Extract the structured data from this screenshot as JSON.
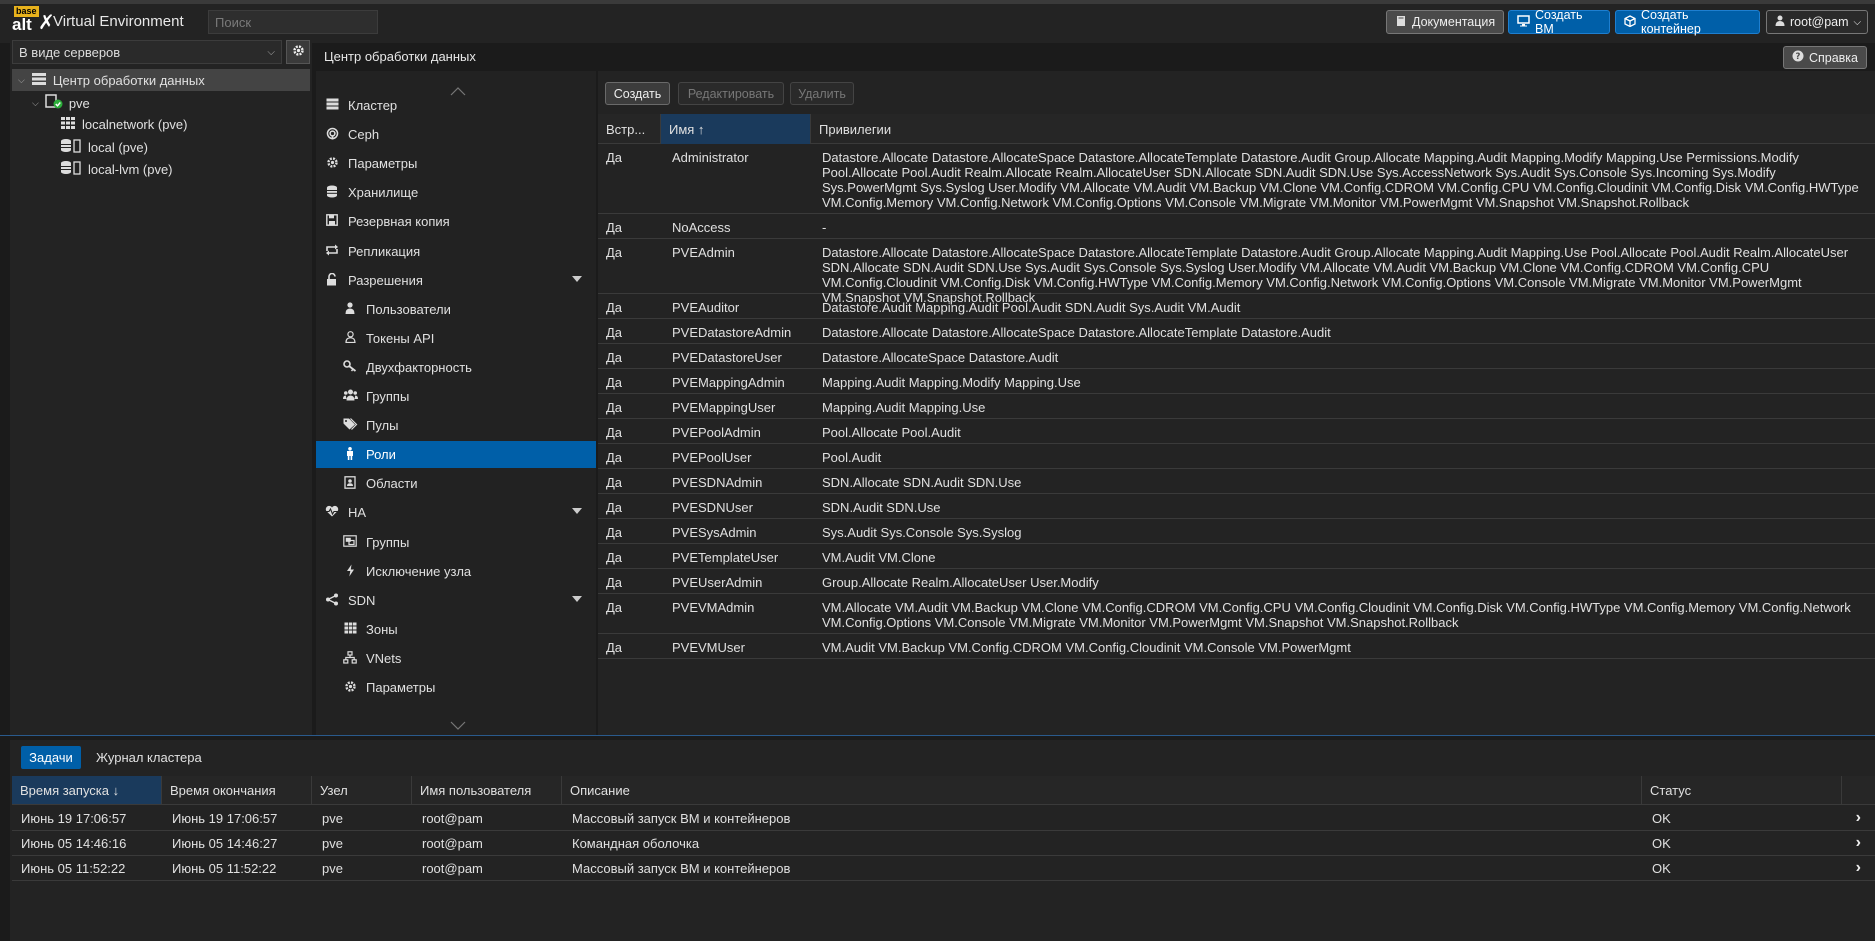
{
  "app": {
    "logo_top": "base",
    "logo_bottom": "alt",
    "title": "Virtual Environment",
    "search_placeholder": "Поиск"
  },
  "topbar": {
    "docs": "Документация",
    "create_vm": "Создать ВМ",
    "create_ct": "Создать контейнер",
    "user": "root@pam"
  },
  "tree": {
    "view": "В виде серверов",
    "datacenter": "Центр обработки данных",
    "node": "pve",
    "storages": [
      "localnetwork (pve)",
      "local (pve)",
      "local-lvm (pve)"
    ]
  },
  "content": {
    "title": "Центр обработки данных",
    "help": "Справка"
  },
  "nav": {
    "items": [
      {
        "label": "Кластер",
        "icon": "server-icon",
        "level": 0
      },
      {
        "label": "Ceph",
        "icon": "ceph-icon",
        "level": 0
      },
      {
        "label": "Параметры",
        "icon": "gear-icon",
        "level": 0
      },
      {
        "label": "Хранилище",
        "icon": "database-icon",
        "level": 0
      },
      {
        "label": "Резервная копия",
        "icon": "floppy-icon",
        "level": 0
      },
      {
        "label": "Репликация",
        "icon": "retweet-icon",
        "level": 0
      },
      {
        "label": "Разрешения",
        "icon": "unlock-icon",
        "level": 0
      },
      {
        "label": "Пользователи",
        "icon": "user-icon",
        "level": 1
      },
      {
        "label": "Токены API",
        "icon": "user-outline-icon",
        "level": 1
      },
      {
        "label": "Двухфакторность",
        "icon": "key-icon",
        "level": 1
      },
      {
        "label": "Группы",
        "icon": "users-icon",
        "level": 1
      },
      {
        "label": "Пулы",
        "icon": "tags-icon",
        "level": 1
      },
      {
        "label": "Роли",
        "icon": "male-icon",
        "level": 1
      },
      {
        "label": "Области",
        "icon": "address-book-icon",
        "level": 1
      },
      {
        "label": "HA",
        "icon": "heartbeat-icon",
        "level": 0
      },
      {
        "label": "Группы",
        "icon": "object-group-icon",
        "level": 1
      },
      {
        "label": "Исключение узла",
        "icon": "bolt-icon",
        "level": 1
      },
      {
        "label": "SDN",
        "icon": "sdn-icon",
        "level": 0
      },
      {
        "label": "Зоны",
        "icon": "th-icon",
        "level": 1
      },
      {
        "label": "VNets",
        "icon": "network-icon",
        "level": 1
      },
      {
        "label": "Параметры",
        "icon": "gear-icon",
        "level": 1
      }
    ]
  },
  "roles": {
    "toolbar": {
      "create": "Создать",
      "edit": "Редактировать",
      "delete": "Удалить"
    },
    "columns": {
      "builtin": "Встр...",
      "name": "Имя ↑",
      "privs": "Привилегии"
    },
    "rows": [
      {
        "builtin": "Да",
        "name": "Administrator",
        "privs": "Datastore.Allocate Datastore.AllocateSpace Datastore.AllocateTemplate Datastore.Audit Group.Allocate Mapping.Audit Mapping.Modify Mapping.Use Permissions.Modify Pool.Allocate Pool.Audit Realm.Allocate Realm.AllocateUser SDN.Allocate SDN.Audit SDN.Use Sys.AccessNetwork Sys.Audit Sys.Console Sys.Incoming Sys.Modify Sys.PowerMgmt Sys.Syslog User.Modify VM.Allocate VM.Audit VM.Backup VM.Clone VM.Config.CDROM VM.Config.CPU VM.Config.Cloudinit VM.Config.Disk VM.Config.HWType VM.Config.Memory VM.Config.Network VM.Config.Options VM.Console VM.Migrate VM.Monitor VM.PowerMgmt VM.Snapshot VM.Snapshot.Rollback"
      },
      {
        "builtin": "Да",
        "name": "NoAccess",
        "privs": "-"
      },
      {
        "builtin": "Да",
        "name": "PVEAdmin",
        "privs": "Datastore.Allocate Datastore.AllocateSpace Datastore.AllocateTemplate Datastore.Audit Group.Allocate Mapping.Audit Mapping.Use Pool.Allocate Pool.Audit Realm.AllocateUser SDN.Allocate SDN.Audit SDN.Use Sys.Audit Sys.Console Sys.Syslog User.Modify VM.Allocate VM.Audit VM.Backup VM.Clone VM.Config.CDROM VM.Config.CPU VM.Config.Cloudinit VM.Config.Disk VM.Config.HWType VM.Config.Memory VM.Config.Network VM.Config.Options VM.Console VM.Migrate VM.Monitor VM.PowerMgmt VM.Snapshot VM.Snapshot.Rollback"
      },
      {
        "builtin": "Да",
        "name": "PVEAuditor",
        "privs": "Datastore.Audit Mapping.Audit Pool.Audit SDN.Audit Sys.Audit VM.Audit"
      },
      {
        "builtin": "Да",
        "name": "PVEDatastoreAdmin",
        "privs": "Datastore.Allocate Datastore.AllocateSpace Datastore.AllocateTemplate Datastore.Audit"
      },
      {
        "builtin": "Да",
        "name": "PVEDatastoreUser",
        "privs": "Datastore.AllocateSpace Datastore.Audit"
      },
      {
        "builtin": "Да",
        "name": "PVEMappingAdmin",
        "privs": "Mapping.Audit Mapping.Modify Mapping.Use"
      },
      {
        "builtin": "Да",
        "name": "PVEMappingUser",
        "privs": "Mapping.Audit Mapping.Use"
      },
      {
        "builtin": "Да",
        "name": "PVEPoolAdmin",
        "privs": "Pool.Allocate Pool.Audit"
      },
      {
        "builtin": "Да",
        "name": "PVEPoolUser",
        "privs": "Pool.Audit"
      },
      {
        "builtin": "Да",
        "name": "PVESDNAdmin",
        "privs": "SDN.Allocate SDN.Audit SDN.Use"
      },
      {
        "builtin": "Да",
        "name": "PVESDNUser",
        "privs": "SDN.Audit SDN.Use"
      },
      {
        "builtin": "Да",
        "name": "PVESysAdmin",
        "privs": "Sys.Audit Sys.Console Sys.Syslog"
      },
      {
        "builtin": "Да",
        "name": "PVETemplateUser",
        "privs": "VM.Audit VM.Clone"
      },
      {
        "builtin": "Да",
        "name": "PVEUserAdmin",
        "privs": "Group.Allocate Realm.AllocateUser User.Modify"
      },
      {
        "builtin": "Да",
        "name": "PVEVMAdmin",
        "privs": "VM.Allocate VM.Audit VM.Backup VM.Clone VM.Config.CDROM VM.Config.CPU VM.Config.Cloudinit VM.Config.Disk VM.Config.HWType VM.Config.Memory VM.Config.Network VM.Config.Options VM.Console VM.Migrate VM.Monitor VM.PowerMgmt VM.Snapshot VM.Snapshot.Rollback"
      },
      {
        "builtin": "Да",
        "name": "PVEVMUser",
        "privs": "VM.Audit VM.Backup VM.Config.CDROM VM.Config.Cloudinit VM.Console VM.PowerMgmt"
      }
    ]
  },
  "tasks": {
    "tabs": {
      "tasks": "Задачи",
      "log": "Журнал кластера"
    },
    "columns": {
      "start": "Время запуска ↓",
      "end": "Время окончания",
      "node": "Узел",
      "user": "Имя пользователя",
      "desc": "Описание",
      "status": "Статус"
    },
    "rows": [
      {
        "start": "Июнь 19 17:06:57",
        "end": "Июнь 19 17:06:57",
        "node": "pve",
        "user": "root@pam",
        "desc": "Массовый запуск ВМ и контейнеров",
        "status": "OK"
      },
      {
        "start": "Июнь 05 14:46:16",
        "end": "Июнь 05 14:46:27",
        "node": "pve",
        "user": "root@pam",
        "desc": "Командная оболочка",
        "status": "OK"
      },
      {
        "start": "Июнь 05 11:52:22",
        "end": "Июнь 05 11:52:22",
        "node": "pve",
        "user": "root@pam",
        "desc": "Массовый запуск ВМ и контейнеров",
        "status": "OK"
      }
    ]
  }
}
